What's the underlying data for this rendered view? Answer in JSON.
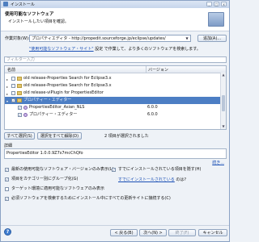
{
  "window": {
    "title": "インストール",
    "minimize": "_",
    "maximize": "□",
    "close": "x"
  },
  "banner": {
    "title": "使用可能なソフトウェア",
    "subtitle": "インストールしたい項目を確認。"
  },
  "work_with": {
    "label": "作業対象(W):",
    "value": "プロパティエディタ - http://propedit.sourceforge.jp/eclipse/updates/",
    "add_button": "追加(A)..."
  },
  "hint": {
    "link": "\"使用可能なソフトウェア・サイト\"",
    "text": "設定 で作業して、より多くのソフトウェアを検索します。"
  },
  "filter": {
    "placeholder": "フィルター入力"
  },
  "table": {
    "headers": {
      "name": "名前",
      "version": "バージョン"
    },
    "rows": [
      {
        "name": "old release-Properties Search for Eclipse3.x",
        "version": "",
        "selected": false,
        "checked": false,
        "icon": "folder-icon"
      },
      {
        "name": "old release-Properties Search for Eclipse3.x",
        "version": "",
        "selected": false,
        "checked": false,
        "icon": "folder-icon"
      },
      {
        "name": "old release-viPlugin for PropertiesEditor",
        "version": "",
        "selected": false,
        "checked": false,
        "icon": "folder-icon"
      },
      {
        "name": "プロパティー・エディター",
        "version": "",
        "selected": true,
        "checked": true,
        "icon": "folder-icon"
      },
      {
        "name": "PropertiesEditor_Asian_NLS",
        "version": "6.0.0",
        "selected": false,
        "checked": true,
        "icon": "plugin-icon"
      },
      {
        "name": "プロパティー・エディター",
        "version": "6.0.0",
        "selected": false,
        "checked": true,
        "icon": "plugin-icon"
      }
    ]
  },
  "buttons": {
    "select_all": "すべて選択(S)",
    "deselect_all": "選択をすべて解除(D)"
  },
  "status": "2 項目が選択されました",
  "details": {
    "label": "詳細",
    "text": "PropertiesEditor 1.0.0.9Z7s7mcChQfo",
    "more": "続き..."
  },
  "options": {
    "latest_only": "最新の使用可能なソフトウェア・バージョンのみ表示(L)",
    "hide_installed": "すでにインストールされている項目を隠す(H)",
    "group_by_category": "項目をカテゴリー別にグループ化(G)",
    "already_installed_q": "すでにインストールされている",
    "already_installed_suffix": "のは?",
    "target_env": "ターゲット環境に適用可能なソフトウェアのみ表示",
    "contact_all": "必須ソフトウェアを検索するためにインストール中にすべての更新サイトに接続する(C)"
  },
  "footer": {
    "help": "?",
    "back": "< 戻る(B)",
    "next": "次へ(N) >",
    "finish": "終了(F)",
    "cancel": "キャンセル"
  },
  "colors": {
    "selection": "#4c7ec4",
    "link": "#1a4fb5"
  }
}
